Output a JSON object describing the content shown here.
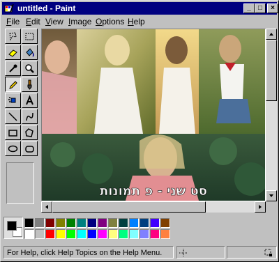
{
  "window": {
    "title": "untitled - Paint",
    "controls": {
      "minimize": "_",
      "maximize": "□",
      "close": "×"
    }
  },
  "menu": [
    {
      "label": "File",
      "mnemonic": "F",
      "rest": "ile"
    },
    {
      "label": "Edit",
      "mnemonic": "E",
      "rest": "dit"
    },
    {
      "label": "View",
      "mnemonic": "V",
      "rest": "iew"
    },
    {
      "label": "Image",
      "mnemonic": "I",
      "rest": "mage"
    },
    {
      "label": "Options",
      "mnemonic": "O",
      "rest": "ptions"
    },
    {
      "label": "Help",
      "mnemonic": "H",
      "rest": "elp"
    }
  ],
  "tools": [
    "free-form-select",
    "select",
    "eraser",
    "fill-with-color",
    "pick-color",
    "magnifier",
    "pencil",
    "brush",
    "airbrush",
    "text",
    "line",
    "curve",
    "rectangle",
    "polygon",
    "ellipse",
    "rounded-rectangle"
  ],
  "selected_tool": "pencil",
  "canvas": {
    "overlay_text": "סט שני - פ תמונות",
    "photo_theme": "collage of portrait photos with foliage background"
  },
  "palette": {
    "foreground": "#000000",
    "background": "#ffffff",
    "row1": [
      "#000000",
      "#808080",
      "#800000",
      "#808000",
      "#008000",
      "#008080",
      "#000080",
      "#800080",
      "#808040",
      "#004040",
      "#0080ff",
      "#004080",
      "#4000ff",
      "#804000"
    ],
    "row2": [
      "#ffffff",
      "#c0c0c0",
      "#ff0000",
      "#ffff00",
      "#00ff00",
      "#00ffff",
      "#0000ff",
      "#ff00ff",
      "#ffff80",
      "#00ff80",
      "#80ffff",
      "#8080ff",
      "#ff0080",
      "#ff8040"
    ]
  },
  "status": {
    "help_text": "For Help, click Help Topics on the Help Menu."
  }
}
